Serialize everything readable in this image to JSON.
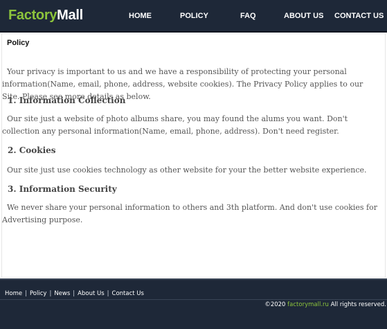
{
  "header": {
    "logo_part1": "Factory",
    "logo_part2": "Mall",
    "nav": [
      {
        "label": "HOME"
      },
      {
        "label": "POLICY"
      },
      {
        "label": "FAQ"
      },
      {
        "label": "ABOUT US"
      },
      {
        "label": "CONTACT US"
      }
    ]
  },
  "page": {
    "title": "Policy",
    "intro": "Your privacy is important to us and we have a responsibility of protecting your personal information(Name, email, phone, address, website cookies). The Privacy Policy applies to our Site. Please see more details as below.",
    "sections": [
      {
        "heading": "1. Information Collection",
        "text": "Our site just a website of photo albums share, you may found the alums you want. Don't collection any personal information(Name, email, phone, address). Don't need register."
      },
      {
        "heading": "2. Cookies",
        "text": "Our site just use cookies technology as other website for your the better website experience."
      },
      {
        "heading": "3. Information Security",
        "text": "We never share your personal information to others and 3th platform. And don't use cookies for Advertising purpose."
      }
    ]
  },
  "footer": {
    "links": [
      {
        "label": "Home"
      },
      {
        "label": "Policy"
      },
      {
        "label": "News"
      },
      {
        "label": "About Us"
      },
      {
        "label": "Contact Us"
      }
    ],
    "separator": "|",
    "copyright_prefix": "©2020",
    "copyright_site": "factorymall.ru",
    "copyright_suffix": "All rights reserved."
  },
  "colors": {
    "header_bg": "#1e2838",
    "brand_green": "#8cc43c"
  }
}
